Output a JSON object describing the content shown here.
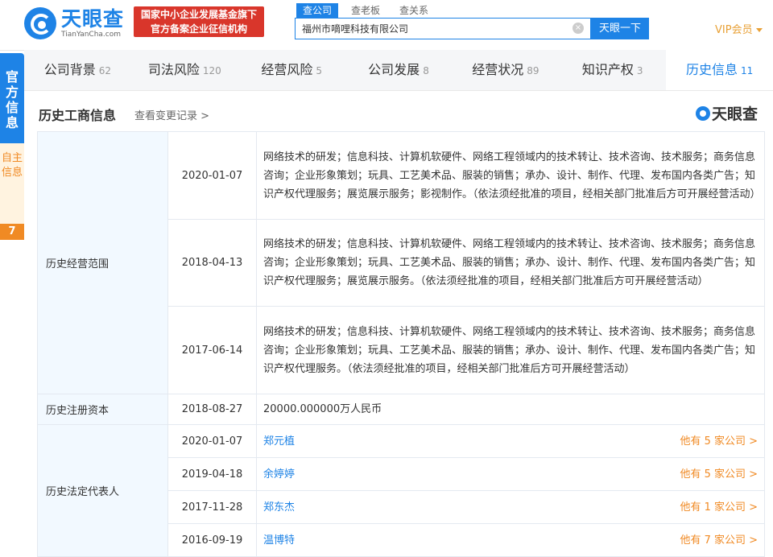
{
  "brand": {
    "title": "天眼查",
    "subtitle": "TianYanCha.com",
    "banner_line1": "国家中小企业发展基金旗下",
    "banner_line2": "官方备案企业征信机构"
  },
  "search": {
    "tabs": [
      "查公司",
      "查老板",
      "查关系"
    ],
    "query": "福州市嘀哩科技有限公司",
    "clear_icon": "×",
    "button": "天眼一下"
  },
  "vip": "VIP会员",
  "side": {
    "official": "官方信息",
    "self": "自主信息",
    "self_count": "7"
  },
  "tabs": [
    {
      "label": "公司背景",
      "count": "62"
    },
    {
      "label": "司法风险",
      "count": "120"
    },
    {
      "label": "经营风险",
      "count": "5"
    },
    {
      "label": "公司发展",
      "count": "8"
    },
    {
      "label": "经营状况",
      "count": "89"
    },
    {
      "label": "知识产权",
      "count": "3"
    },
    {
      "label": "历史信息",
      "count": "11"
    }
  ],
  "section": {
    "title": "历史工商信息",
    "link": "查看变更记录 >",
    "watermark": "天眼查"
  },
  "history": {
    "scope_label": "历史经营范围",
    "scopes": [
      {
        "date": "2020-01-07",
        "text": "网络技术的研发；信息科技、计算机软硬件、网络工程领域内的技术转让、技术咨询、技术服务；商务信息咨询；企业形象策划；玩具、工艺美术品、服装的销售；承办、设计、制作、代理、发布国内各类广告；知识产权代理服务；展览展示服务；影视制作。（依法须经批准的项目，经相关部门批准后方可开展经营活动）"
      },
      {
        "date": "2018-04-13",
        "text": "网络技术的研发；信息科技、计算机软硬件、网络工程领域内的技术转让、技术咨询、技术服务；商务信息咨询；企业形象策划；玩具、工艺美术品、服装的销售；承办、设计、制作、代理、发布国内各类广告；知识产权代理服务；展览展示服务。（依法须经批准的项目，经相关部门批准后方可开展经营活动）"
      },
      {
        "date": "2017-06-14",
        "text": "网络技术的研发；信息科技、计算机软硬件、网络工程领域内的技术转让、技术咨询、技术服务；商务信息咨询；企业形象策划；玩具、工艺美术品、服装的销售；承办、设计、制作、代理、发布国内各类广告；知识产权代理服务。（依法须经批准的项目，经相关部门批准后方可开展经营活动）"
      }
    ],
    "capital_label": "历史注册资本",
    "capital": {
      "date": "2018-08-27",
      "value": "20000.000000万人民币"
    },
    "rep_label": "历史法定代表人",
    "reps": [
      {
        "date": "2020-01-07",
        "name": "郑元植",
        "link": "他有 5 家公司 >"
      },
      {
        "date": "2019-04-18",
        "name": "余婷婷",
        "link": "他有 5 家公司 >"
      },
      {
        "date": "2017-11-28",
        "name": "郑东杰",
        "link": "他有 1 家公司 >"
      },
      {
        "date": "2016-09-19",
        "name": "温博特",
        "link": "他有 7 家公司 >"
      }
    ]
  },
  "icons": {
    "logo": "tianyancha-logo-icon",
    "clear": "clear-icon",
    "caret": "caret-down-icon"
  },
  "colors": {
    "brand_blue": "#1e83e6",
    "orange": "#f08a24",
    "banner_red": "#d9362b",
    "cat_bg": "#f2f9ff"
  }
}
